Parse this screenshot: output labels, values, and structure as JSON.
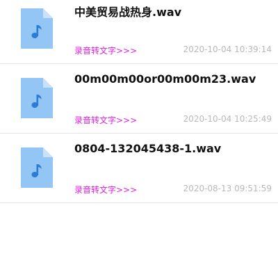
{
  "files": [
    {
      "name": "中美贸易战热身.wav",
      "convert_label": "录音转文字>>>",
      "timestamp": "2020-10-04 10:39:14",
      "icon": "audio-file-icon"
    },
    {
      "name": "00m00m00or00m00m23.wav",
      "convert_label": "录音转文字>>>",
      "timestamp": "2020-10-04 10:25:49",
      "icon": "audio-file-icon"
    },
    {
      "name": "0804-132045438-1.wav",
      "convert_label": "录音转文字>>>",
      "timestamp": "2020-08-13 09:51:59",
      "icon": "audio-file-icon"
    }
  ],
  "colors": {
    "icon_body": "#93c6f5",
    "icon_fold": "#c9e2fa",
    "note": "#2a7dd6",
    "link": "#e01ee0",
    "timestamp": "#b9b9b9",
    "divider": "#e4e4e4"
  }
}
